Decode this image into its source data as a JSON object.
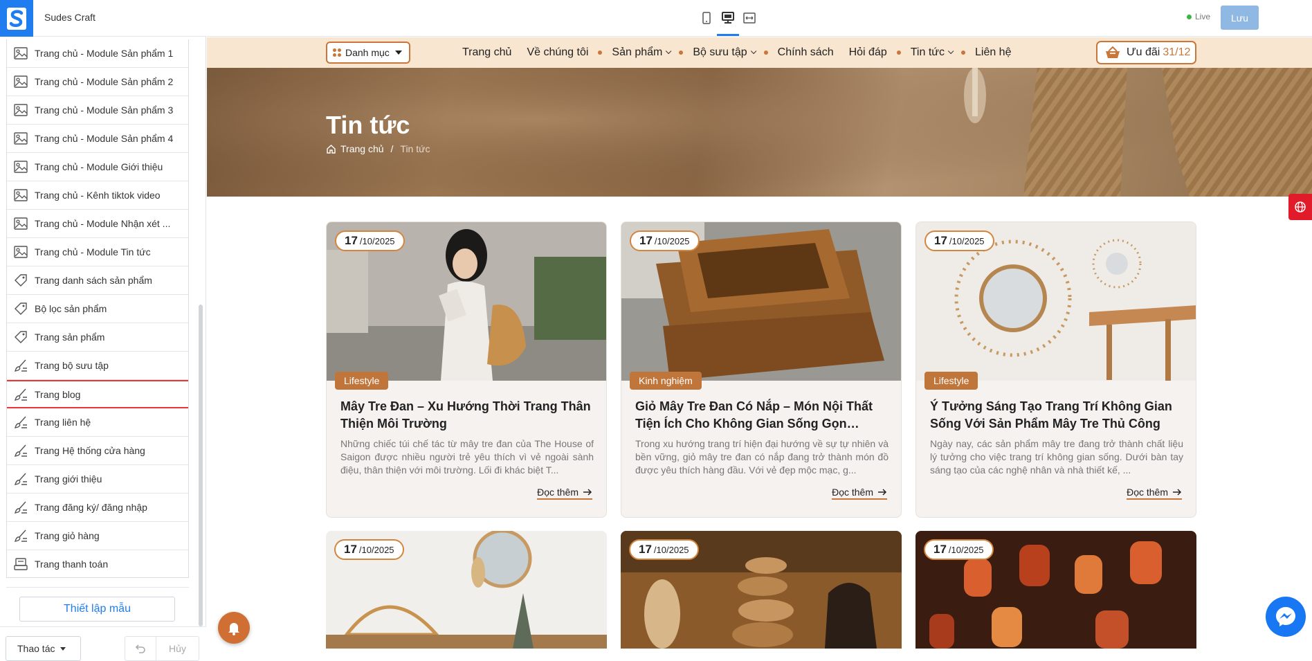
{
  "app": {
    "brand": "Sudes Craft"
  },
  "sidebar": {
    "items": [
      {
        "label": "Trang chủ - Module Sản phẩm 1",
        "icon": "image-layout-icon"
      },
      {
        "label": "Trang chủ - Module Sản phẩm 2",
        "icon": "image-layout-icon"
      },
      {
        "label": "Trang chủ - Module Sản phẩm 3",
        "icon": "image-layout-icon"
      },
      {
        "label": "Trang chủ - Module Sản phẩm 4",
        "icon": "image-layout-icon"
      },
      {
        "label": "Trang chủ - Module Giới thiệu",
        "icon": "image-layout-icon"
      },
      {
        "label": "Trang chủ - Kênh tiktok video",
        "icon": "image-layout-icon"
      },
      {
        "label": "Trang chủ - Module Nhận xét ...",
        "icon": "image-layout-icon"
      },
      {
        "label": "Trang chủ - Module Tin tức",
        "icon": "image-layout-icon"
      },
      {
        "label": "Trang danh sách sản phẩm",
        "icon": "tag-icon"
      },
      {
        "label": "Bộ lọc sản phẩm",
        "icon": "tag-icon"
      },
      {
        "label": "Trang sản phẩm",
        "icon": "tag-icon"
      },
      {
        "label": "Trang bộ sưu tập",
        "icon": "brush-icon"
      },
      {
        "label": "Trang blog",
        "icon": "brush-icon",
        "active": true
      },
      {
        "label": "Trang liên hệ",
        "icon": "brush-icon"
      },
      {
        "label": "Trang Hệ thống cửa hàng",
        "icon": "brush-icon"
      },
      {
        "label": "Trang giới thiệu",
        "icon": "brush-icon"
      },
      {
        "label": "Trang đăng ký/ đăng nhập",
        "icon": "brush-icon"
      },
      {
        "label": "Trang giỏ hàng",
        "icon": "brush-icon"
      },
      {
        "label": "Trang thanh toán",
        "icon": "register-icon"
      }
    ],
    "template_button": "Thiết lập mẫu",
    "actions_button": "Thao tác",
    "cancel_button": "Hủy"
  },
  "toolbar": {
    "devices": [
      "mobile-icon",
      "desktop-icon",
      "fullwidth-icon"
    ],
    "active_device": "desktop-icon",
    "live_label": "Live",
    "save_label": "Lưu"
  },
  "site": {
    "category_button": "Danh mục",
    "menu": [
      {
        "label": "Trang chủ",
        "dropdown": false
      },
      {
        "label": "Về chúng tôi",
        "dropdown": false
      },
      {
        "label": "Sản phẩm",
        "dropdown": true
      },
      {
        "label": "Bộ sưu tập",
        "dropdown": true
      },
      {
        "label": "Chính sách",
        "dropdown": false
      },
      {
        "label": "Hỏi đáp",
        "dropdown": false
      },
      {
        "label": "Tin tức",
        "dropdown": true
      },
      {
        "label": "Liên hệ",
        "dropdown": false
      }
    ],
    "deal": {
      "label": "Ưu đãi",
      "count": "31/12"
    },
    "hero": {
      "title": "Tin tức",
      "breadcrumb_home": "Trang chủ",
      "breadcrumb_sep": "/",
      "breadcrumb_current": "Tin tức"
    },
    "read_more": "Đọc thêm",
    "posts": [
      {
        "day": "17",
        "month_year": "/10/2025",
        "tag": "Lifestyle",
        "title": "Mây Tre Đan – Xu Hướng Thời Trang Thân Thiện Môi Trường",
        "excerpt": "Những chiếc túi chế tác từ mây tre đan của The House of Saigon được nhiều người trẻ yêu thích vì vẻ ngoài sành điệu, thân thiện với môi trường. Lối đi khác biệt T..."
      },
      {
        "day": "17",
        "month_year": "/10/2025",
        "tag": "Kinh nghiệm",
        "title": "Giỏ Mây Tre Đan Có Nắp – Món Nội Thất Tiện Ích Cho Không Gian Sống Gọn Gàng...",
        "excerpt": "Trong xu hướng trang trí hiện đại hướng về sự tự nhiên và bền vững, giỏ mây tre đan có nắp đang trở thành món đồ được yêu thích hàng đầu. Với vẻ đẹp mộc mạc, g..."
      },
      {
        "day": "17",
        "month_year": "/10/2025",
        "tag": "Lifestyle",
        "title": "Ý Tưởng Sáng Tạo Trang Trí Không Gian Sống Với Sản Phẩm Mây Tre Thủ Công",
        "excerpt": "Ngày nay, các sản phẩm mây tre đang trở thành chất liệu lý tưởng cho việc trang trí không gian sống. Dưới bàn tay sáng tạo của các nghệ nhân và nhà thiết kế, ..."
      },
      {
        "day": "17",
        "month_year": "/10/2025"
      },
      {
        "day": "17",
        "month_year": "/10/2025"
      },
      {
        "day": "17",
        "month_year": "/10/2025"
      }
    ]
  },
  "colors": {
    "accent": "#1f7df0",
    "brand_orange": "#c8763a",
    "nav_bg": "#f8e6d0",
    "active_outline": "#e33333",
    "save_bg": "#8fb8e2"
  }
}
